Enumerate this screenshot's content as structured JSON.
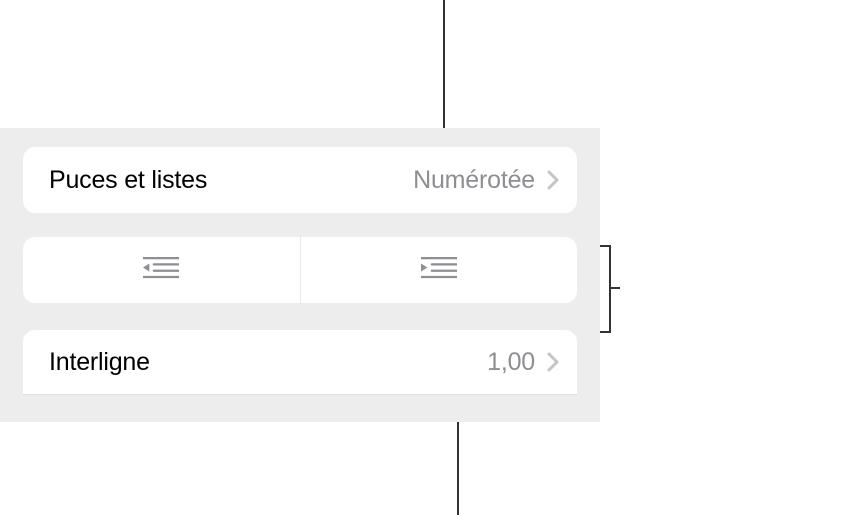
{
  "bullets": {
    "label": "Puces et listes",
    "value": "Numérotée"
  },
  "indent": {
    "decrease": "decrease-indent",
    "increase": "increase-indent"
  },
  "linespacing": {
    "label": "Interligne",
    "value": "1,00"
  }
}
